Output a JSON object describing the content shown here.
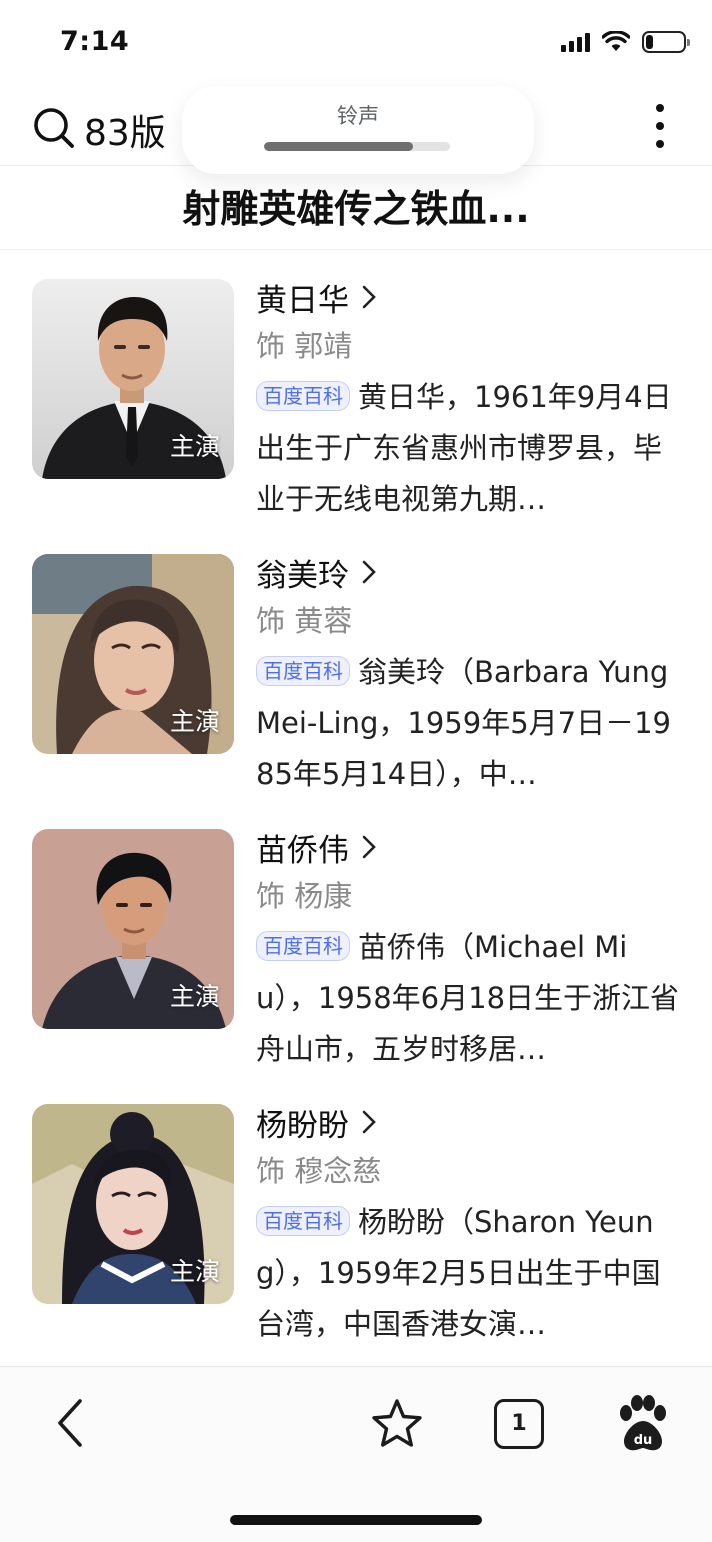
{
  "status_bar": {
    "time": "7:14"
  },
  "toolbar": {
    "query_text": "83版",
    "ringtone_label": "铃声",
    "ringtone_volume": 0.8
  },
  "page": {
    "title": "射雕英雄传之铁血..."
  },
  "cast": [
    {
      "name": "黄日华",
      "role": "饰 郭靖",
      "badge": "主演",
      "source_tag": "百度百科",
      "bio": "黄日华，1961年9月4日出生于广东省惠州市博罗县，毕业于无线电视第九期…"
    },
    {
      "name": "翁美玲",
      "role": "饰 黄蓉",
      "badge": "主演",
      "source_tag": "百度百科",
      "bio": "翁美玲（Barbara Yung Mei-Ling，1959年5月7日－1985年5月14日），中…"
    },
    {
      "name": "苗侨伟",
      "role": "饰 杨康",
      "badge": "主演",
      "source_tag": "百度百科",
      "bio": "苗侨伟（Michael Miu），1958年6月18日生于浙江省舟山市，五岁时移居…"
    },
    {
      "name": "杨盼盼",
      "role": "饰 穆念慈",
      "badge": "主演",
      "source_tag": "百度百科",
      "bio": "杨盼盼（Sharon Yeung），1959年2月5日出生于中国台湾，中国香港女演…"
    }
  ],
  "bottom_bar": {
    "tab_count": "1"
  },
  "icons": {
    "search": "search-icon",
    "bell_muted": "bell-muted-icon",
    "more": "more-vertical-icon",
    "chevron": "chevron-right-icon",
    "back": "back-arrow-icon",
    "star": "star-icon",
    "tabs": "tabs-icon",
    "baidu": "baidu-paw-icon"
  },
  "colors": {
    "accent_blue": "#4e6ef2",
    "bell_red": "#e53935",
    "secondary_text": "#8a8a8a"
  }
}
